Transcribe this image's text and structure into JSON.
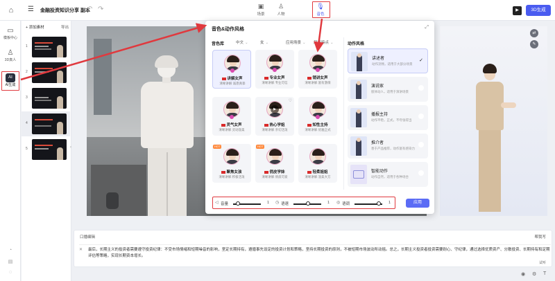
{
  "header": {
    "title": "金融投资知识分享 副本",
    "tabs": [
      {
        "label": "场景",
        "icon": "scene-icon"
      },
      {
        "label": "人物",
        "icon": "person-icon"
      },
      {
        "label": "音色",
        "icon": "microphone-icon"
      }
    ],
    "generate_label": "3D生成"
  },
  "leftnav": {
    "items": [
      {
        "label": "模板中心",
        "icon": "template-icon"
      },
      {
        "label": "3D真人",
        "icon": "person-3d-icon"
      },
      {
        "label": "AI生成",
        "icon": "ai-icon"
      }
    ]
  },
  "scenes": {
    "add_label": "+ 添加素材",
    "import_label": "导出",
    "items": [
      {
        "num": "1"
      },
      {
        "num": "2"
      },
      {
        "num": "3"
      },
      {
        "num": "4"
      },
      {
        "num": "5"
      }
    ]
  },
  "dialog": {
    "title": "音色&动作风格",
    "voice_lib_label": "音色库",
    "filters": [
      "中文",
      "女",
      "应用场景",
      "风格特点"
    ],
    "style_title": "动作风格",
    "voices": [
      {
        "name": "讲解女声",
        "desc": "清晰讲解 诚恳真挚",
        "tag": ""
      },
      {
        "name": "专业女声",
        "desc": "清晰讲解 专业可信",
        "tag": ""
      },
      {
        "name": "销讲女声",
        "desc": "清晰讲解 富有激情",
        "tag": ""
      },
      {
        "name": "灵气女声",
        "desc": "清晰讲解 灵动温柔",
        "tag": ""
      },
      {
        "name": "热心学姐",
        "desc": "清晰讲解 亲切活泼",
        "tag": ""
      },
      {
        "name": "知性主持",
        "desc": "清晰讲解 优雅正式",
        "tag": ""
      },
      {
        "name": "聚焦女孩",
        "desc": "清晰讲解 积极活泼",
        "tag": "HOT"
      },
      {
        "name": "俏皮学妹",
        "desc": "清晰讲解 俏皮可爱",
        "tag": "HOT"
      },
      {
        "name": "轻柔姐姐",
        "desc": "清晰讲解 温柔大方",
        "tag": ""
      }
    ],
    "styles": [
      {
        "title": "讲述者",
        "desc": "动作流畅，适用于大部分场景"
      },
      {
        "title": "演说家",
        "desc": "肢体动人，适用于演讲场景"
      },
      {
        "title": "播报主持",
        "desc": "动作平稳，正式，不夸张得当"
      },
      {
        "title": "推介者",
        "desc": "善于产品推荐，动作富有感染力"
      },
      {
        "title": "智能动作",
        "desc": "动作自然，适用于各种场合"
      }
    ],
    "controls": [
      {
        "label": "音量",
        "value": "1",
        "icon": "volume-icon"
      },
      {
        "label": "语速",
        "value": "1",
        "icon": "speed-icon"
      },
      {
        "label": "语调",
        "value": "1",
        "icon": "pitch-icon"
      }
    ],
    "apply_label": "应用"
  },
  "editor": {
    "title": "口播编辑",
    "help_label": "帮我写",
    "text": "最后，长期主义的投资者需要遵守投资纪律：不受市场情绪和短期噪音的影响，坚定长期持有，遵循事先设定的投资计划和策略，坚持长期投资的原则，不被短期市场波动所动摇。总之，长期主义投资者投资需要耐心、守纪律，通过选择优质资产、分散投资、长期持有和定期评估等策略，实现长期资本增长。",
    "count_label": "试听"
  }
}
